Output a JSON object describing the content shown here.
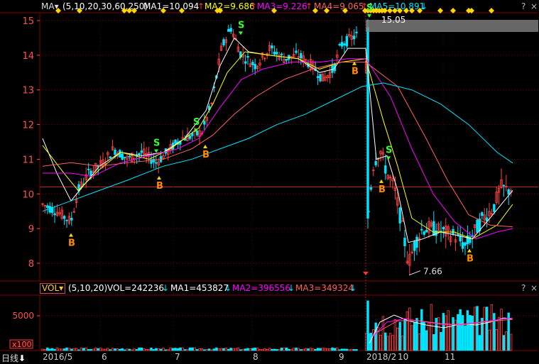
{
  "indicator_bar": {
    "ma_label": "MA▾",
    "params": "(5,10,20,30,60,250)",
    "ma1": "MA1=10.094",
    "ma2": "MA2=9.686",
    "ma3": "MA3=9.226",
    "ma4": "MA4=9.065",
    "ma5": "MA5=10.891",
    "help": "?",
    "close": "×",
    "colors": {
      "params": "#ffffff",
      "ma1": "#ffffff",
      "ma2": "#ffff00",
      "ma3": "#ff00ff",
      "ma4": "#ff6060",
      "ma5": "#00e5ff",
      "arrow_up": "#ff3030",
      "arrow_down": "#00e5ff"
    }
  },
  "volume_bar": {
    "selector": "VOL",
    "params": "(5,10,20)",
    "vol": "VOL=242236",
    "ma1": "MA1=453827",
    "ma2": "MA2=396556",
    "ma3": "MA3=349324",
    "help": "?",
    "close": "×"
  },
  "bottom_bar": {
    "period": "日线",
    "dates": [
      "2016/5",
      "6",
      "7",
      "8",
      "9",
      "2018/2",
      "10",
      "11"
    ]
  },
  "chart_data": {
    "type": "candlestick",
    "y_ticks": [
      "15",
      "14",
      "13",
      "12",
      "11",
      "10",
      "9",
      "8"
    ],
    "ylim": [
      7.6,
      15.3
    ],
    "volume_ticks": [
      "5000"
    ],
    "volume_unit": "x100",
    "annotations": {
      "high_label": "15.05",
      "low_label": "7.66",
      "buy_marker": "B",
      "sell_marker": "S"
    },
    "reference_price": 10.2,
    "colors": {
      "up": "#ff4040",
      "down": "#00e5ff",
      "ma5": "#ffffff",
      "ma10": "#ffff00",
      "ma20": "#ff00ff",
      "ma30": "#ff6060",
      "ma60": "#00e5ff",
      "grid": "#800000",
      "axis_text": "#ff5050"
    }
  }
}
